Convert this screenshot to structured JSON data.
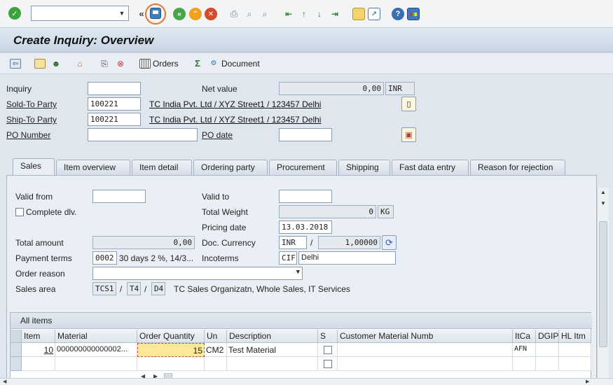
{
  "toolbar": {
    "command_field_value": "",
    "icons": [
      "enter-icon",
      "save-icon",
      "back-icon",
      "exit-icon",
      "cancel-icon",
      "print-icon",
      "find-icon",
      "find-next-icon",
      "first-page-icon",
      "previous-page-icon",
      "next-page-icon",
      "last-page-icon",
      "new-session-icon",
      "shortcut-icon",
      "help-icon",
      "customize-layout-icon"
    ],
    "save_highlight_color": "#e8732a"
  },
  "title": "Create Inquiry: Overview",
  "app_toolbar": {
    "orders_label": "Orders",
    "document_label": "Document"
  },
  "header": {
    "inquiry_label": "Inquiry",
    "inquiry_value": "",
    "net_value_label": "Net value",
    "net_value": "0,00",
    "net_value_currency": "INR",
    "sold_to_label": "Sold-To Party",
    "sold_to_value": "100221",
    "sold_to_desc": "TC India Pvt. Ltd / XYZ Street1 / 123457 Delhi",
    "ship_to_label": "Ship-To Party",
    "ship_to_value": "100221",
    "ship_to_desc": "TC India Pvt. Ltd / XYZ Street1 / 123457 Delhi",
    "po_number_label": "PO Number",
    "po_number_value": "",
    "po_date_label": "PO date",
    "po_date_value": ""
  },
  "tabs": [
    "Sales",
    "Item overview",
    "Item detail",
    "Ordering party",
    "Procurement",
    "Shipping",
    "Fast data entry",
    "Reason for rejection"
  ],
  "active_tab": "Sales",
  "sales": {
    "valid_from_label": "Valid from",
    "valid_from_value": "",
    "valid_to_label": "Valid to",
    "valid_to_value": "",
    "complete_dlv_label": "Complete dlv.",
    "total_weight_label": "Total Weight",
    "total_weight_value": "0",
    "total_weight_unit": "KG",
    "pricing_date_label": "Pricing date",
    "pricing_date_value": "13.03.2018",
    "total_amount_label": "Total amount",
    "total_amount_value": "0,00",
    "doc_currency_label": "Doc. Currency",
    "doc_currency_value": "INR",
    "exchange_rate_sep": "/",
    "exchange_rate_value": "1,00000",
    "payment_terms_label": "Payment terms",
    "payment_terms_code": "0002",
    "payment_terms_desc": "30 days 2 %, 14/3...",
    "incoterms_label": "Incoterms",
    "incoterms_code": "CIF",
    "incoterms_place": "Delhi",
    "order_reason_label": "Order reason",
    "order_reason_value": "",
    "sales_area_label": "Sales area",
    "sales_org": "TCS1",
    "sales_area_sep1": "/",
    "distr_channel": "T4",
    "sales_area_sep2": "/",
    "division": "D4",
    "sales_area_desc": "TC Sales Organizatn, Whole Sales, IT Services"
  },
  "items_table": {
    "title": "All items",
    "columns": [
      "Item",
      "Material",
      "Order Quantity",
      "Un",
      "Description",
      "S",
      "Customer Material Numb",
      "ItCa",
      "DGIP",
      "HL Itm"
    ],
    "rows": [
      {
        "item": "10",
        "material": "000000000000002...",
        "order_quantity": "15",
        "unit": "CM2",
        "description": "Test Material",
        "cust_mat": "",
        "itca": "AFN",
        "dgip": "",
        "hl_itm": ""
      },
      {
        "item": "",
        "material": "",
        "order_quantity": "",
        "unit": "",
        "description": "",
        "cust_mat": "",
        "itca": "",
        "dgip": "",
        "hl_itm": ""
      }
    ]
  }
}
